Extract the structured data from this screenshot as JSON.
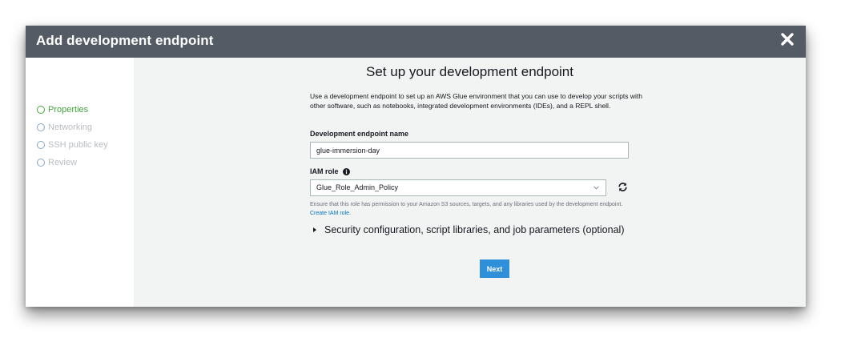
{
  "dialog": {
    "title": "Add development endpoint"
  },
  "sidebar": {
    "steps": [
      {
        "label": "Properties",
        "state": "active"
      },
      {
        "label": "Networking",
        "state": "pending"
      },
      {
        "label": "SSH public key",
        "state": "pending"
      },
      {
        "label": "Review",
        "state": "pending"
      }
    ]
  },
  "main": {
    "heading": "Set up your development endpoint",
    "description": "Use a development endpoint to set up an AWS Glue environment that you can use to develop your scripts with other software, such as notebooks, integrated development environments (IDEs), and a REPL shell.",
    "endpoint_name_label": "Development endpoint name",
    "endpoint_name_value": "glue-immersion-day",
    "iam_role_label": "IAM role",
    "iam_role_value": "Glue_Role_Admin_Policy",
    "iam_help_text": "Ensure that this role has permission to your Amazon S3 sources, targets, and any libraries used by the development endpoint.",
    "create_iam_role_link": "Create IAM role.",
    "expander_label": "Security configuration, script libraries, and job parameters (optional)",
    "next_label": "Next"
  },
  "colors": {
    "header_bg": "#545b64",
    "active_step": "#44a43b",
    "primary_button": "#2f8fd8",
    "link": "#0073bb"
  },
  "icons": {
    "close": "close-icon",
    "info": "info-icon",
    "dropdown": "chevron-down-icon",
    "refresh": "refresh-icon",
    "step": "circle-icon",
    "expander": "caret-right-icon"
  }
}
